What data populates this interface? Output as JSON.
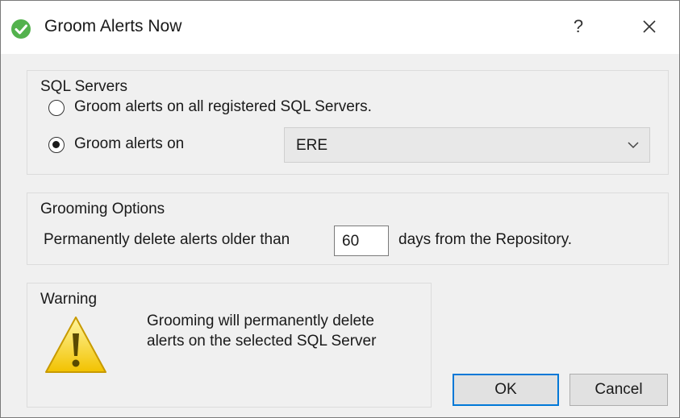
{
  "window": {
    "title": "Groom Alerts Now",
    "help_label": "?",
    "close_label": "✕"
  },
  "sql_servers": {
    "group_label": "SQL Servers",
    "option_all_label": "Groom alerts on all registered SQL Servers.",
    "option_selected_label": "Groom alerts on",
    "selected_option": "selected",
    "server_select": {
      "value": "ERE"
    }
  },
  "grooming_options": {
    "group_label": "Grooming Options",
    "prefix_label": "Permanently delete alerts older than",
    "days_value": "60",
    "suffix_label": "days from the Repository."
  },
  "warning": {
    "group_label": "Warning",
    "message_line1": "Grooming will permanently delete",
    "message_line2": "alerts on the selected SQL Server"
  },
  "buttons": {
    "ok_label": "OK",
    "cancel_label": "Cancel"
  },
  "colors": {
    "accent": "#0078d7",
    "app_icon": "#53b24d",
    "warning_yellow": "#f5d000"
  },
  "icons": {
    "app": "check-circle-icon",
    "help": "question-icon",
    "close": "close-icon",
    "dropdown": "chevron-down-icon",
    "warning": "warning-triangle-icon"
  }
}
